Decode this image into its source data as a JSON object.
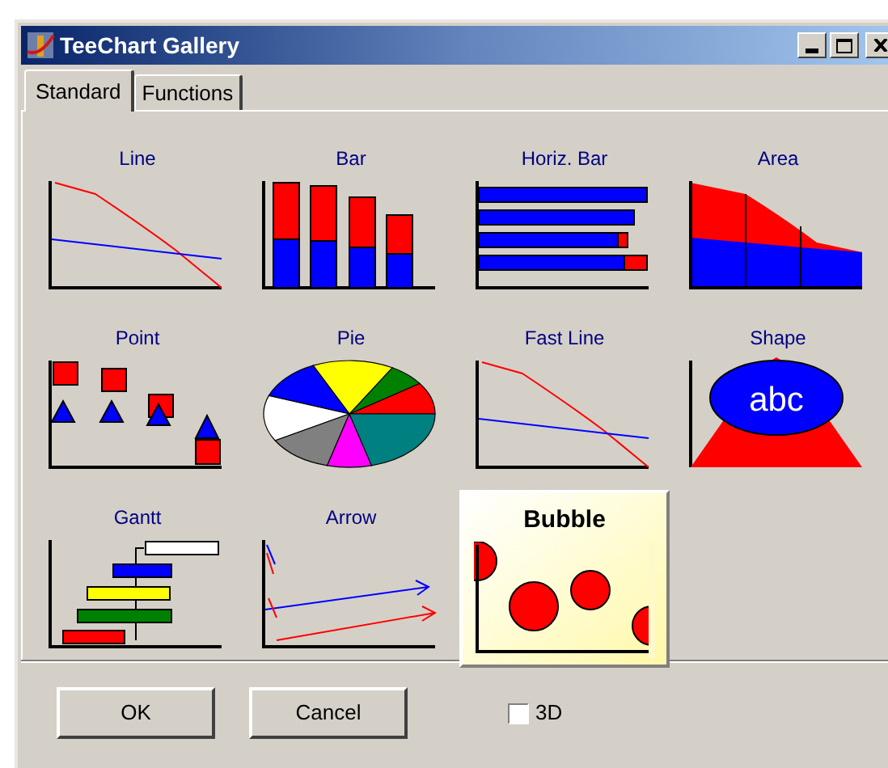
{
  "window": {
    "title": "TeeChart Gallery"
  },
  "tabs": [
    {
      "label": "Standard",
      "selected": true
    },
    {
      "label": "Functions",
      "selected": false
    }
  ],
  "gallery": [
    {
      "label": "Line",
      "kind": "line",
      "selected": false
    },
    {
      "label": "Bar",
      "kind": "bar",
      "selected": false
    },
    {
      "label": "Horiz. Bar",
      "kind": "hbar",
      "selected": false
    },
    {
      "label": "Area",
      "kind": "area",
      "selected": false
    },
    {
      "label": "Point",
      "kind": "point",
      "selected": false
    },
    {
      "label": "Pie",
      "kind": "pie",
      "selected": false
    },
    {
      "label": "Fast Line",
      "kind": "fastline",
      "selected": false
    },
    {
      "label": "Shape",
      "kind": "shape",
      "selected": false,
      "caption": "abc"
    },
    {
      "label": "Gantt",
      "kind": "gantt",
      "selected": false
    },
    {
      "label": "Arrow",
      "kind": "arrow",
      "selected": false
    },
    {
      "label": "Bubble",
      "kind": "bubble",
      "selected": true
    }
  ],
  "buttons": [
    "OK",
    "Cancel"
  ],
  "option": {
    "label": "3D",
    "checked": false
  }
}
